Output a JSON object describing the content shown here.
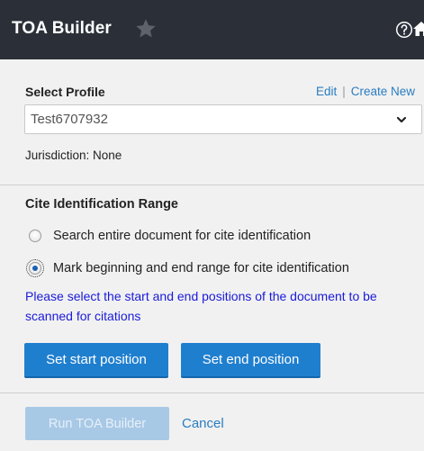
{
  "header": {
    "title": "TOA Builder",
    "favorite_icon": "star-icon",
    "help_icon": "question-circle-icon",
    "home_icon": "home-icon"
  },
  "profile": {
    "label": "Select Profile",
    "edit_link": "Edit",
    "create_link": "Create New",
    "selected_value": "Test6707932",
    "jurisdiction": "Jurisdiction: None"
  },
  "cite_range": {
    "title": "Cite Identification Range",
    "options": [
      {
        "label": "Search entire document for cite identification",
        "checked": false
      },
      {
        "label": "Mark beginning and end range for cite identification",
        "checked": true
      }
    ],
    "info_text": "Please select the start and end positions of the document to be scanned for citations",
    "start_button": "Set start position",
    "end_button": "Set end position"
  },
  "footer": {
    "run_button": "Run TOA Builder",
    "cancel_link": "Cancel"
  },
  "colors": {
    "header_bg": "#2b3038",
    "accent_blue": "#1f7fcf",
    "link_blue": "#2a7dc0",
    "info_text": "#1a1adb",
    "disabled_button": "#a8c9e6"
  }
}
